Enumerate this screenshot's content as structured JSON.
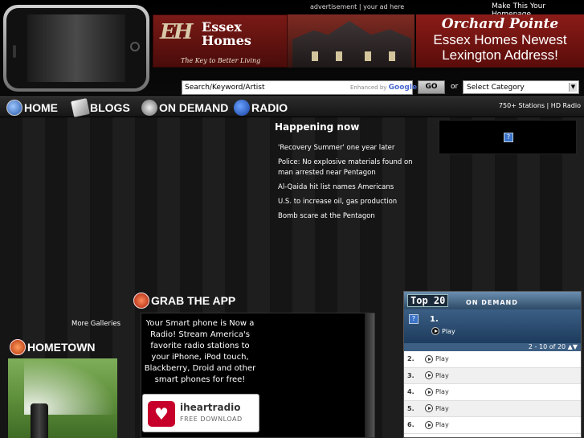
{
  "header": {
    "ad_label": "advertisement | your ad here",
    "homepage_link": "Make This Your Homepage"
  },
  "banner": {
    "logo_mark": "EH",
    "logo_name": "Essex Homes",
    "logo_tagline": "The Key to Better Living",
    "right_title": "Orchard Pointe",
    "right_line1": "Essex Homes Newest",
    "right_line2": "Lexington Address!"
  },
  "search": {
    "placeholder": "Search/Keyword/Artist",
    "enhanced_by": "Enhanced by",
    "google": "Google",
    "go_label": "GO",
    "or_label": "or",
    "category_value": "Select Category"
  },
  "nav": {
    "items": [
      {
        "label": "HOME",
        "icon": "home-globe-icon"
      },
      {
        "label": "BLOGS",
        "icon": "blogs-icon"
      },
      {
        "label": "ON DEMAND",
        "icon": "on-demand-icon"
      },
      {
        "label": "RADIO",
        "icon": "radio-play-icon"
      }
    ],
    "stations_info": "750+ Stations | HD Radio"
  },
  "happening": {
    "title": "Happening now",
    "items": [
      "'Recovery Summer' one year later",
      "Police: No explosive materials found on man arrested near Pentagon",
      "Al-Qaida hit list names Americans",
      "U.S. to increase oil, gas production",
      "Bomb scare at the Pentagon"
    ]
  },
  "grab_app": {
    "title": "GRAB THE APP",
    "text": "Your Smart phone is Now a Radio! Stream America's favorite radio stations to your iPhone, iPod touch, Blackberry, Droid and other smart phones for free!",
    "badge_name": "iheartradio",
    "badge_download": "FREE DOWNLOAD"
  },
  "galleries": {
    "more_label": "More Galleries"
  },
  "hometown": {
    "title": "HOMETOWN"
  },
  "top20": {
    "badge": "Top 20",
    "subtitle": "ON DEMAND",
    "feature_num": "1.",
    "feature_play": "Play",
    "pager": "2 - 10 of 20 ▲▼",
    "rows": [
      {
        "num": "2.",
        "play": "Play"
      },
      {
        "num": "3.",
        "play": "Play"
      },
      {
        "num": "4.",
        "play": "Play"
      },
      {
        "num": "5.",
        "play": "Play"
      },
      {
        "num": "6.",
        "play": "Play"
      }
    ]
  },
  "colors": {
    "banner_red": "#7a1a16",
    "top20_blue": "#2d4a66",
    "iheart_red": "#c6002b"
  }
}
